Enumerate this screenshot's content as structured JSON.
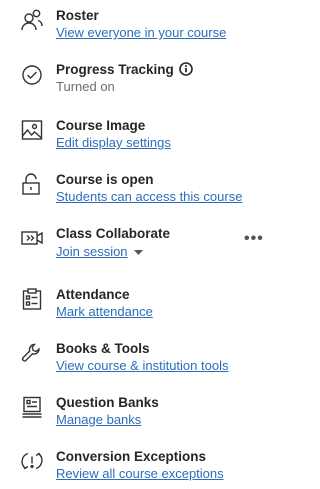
{
  "items": [
    {
      "title": "Roster",
      "subtitle": "View everyone in your course",
      "icon": "people-icon"
    },
    {
      "title": "Progress Tracking",
      "subtitle": "Turned on",
      "icon": "checkmark-circle-icon"
    },
    {
      "title": "Course Image",
      "subtitle": "Edit display settings",
      "icon": "image-icon"
    },
    {
      "title": "Course is open",
      "subtitle": "Students can access this course",
      "icon": "unlock-icon"
    },
    {
      "title": "Class Collaborate",
      "subtitle": "Join session",
      "icon": "collaborate-icon"
    },
    {
      "title": "Attendance",
      "subtitle": "Mark attendance",
      "icon": "clipboard-icon"
    },
    {
      "title": "Books & Tools",
      "subtitle": "View course & institution tools",
      "icon": "wrench-icon"
    },
    {
      "title": "Question Banks",
      "subtitle": "Manage banks",
      "icon": "question-bank-icon"
    },
    {
      "title": "Conversion Exceptions",
      "subtitle": "Review all course exceptions",
      "icon": "exception-icon"
    }
  ],
  "more_label": "•••",
  "colors": {
    "link": "#2a6ebb",
    "text": "#262626",
    "muted": "#6e6e6e"
  }
}
